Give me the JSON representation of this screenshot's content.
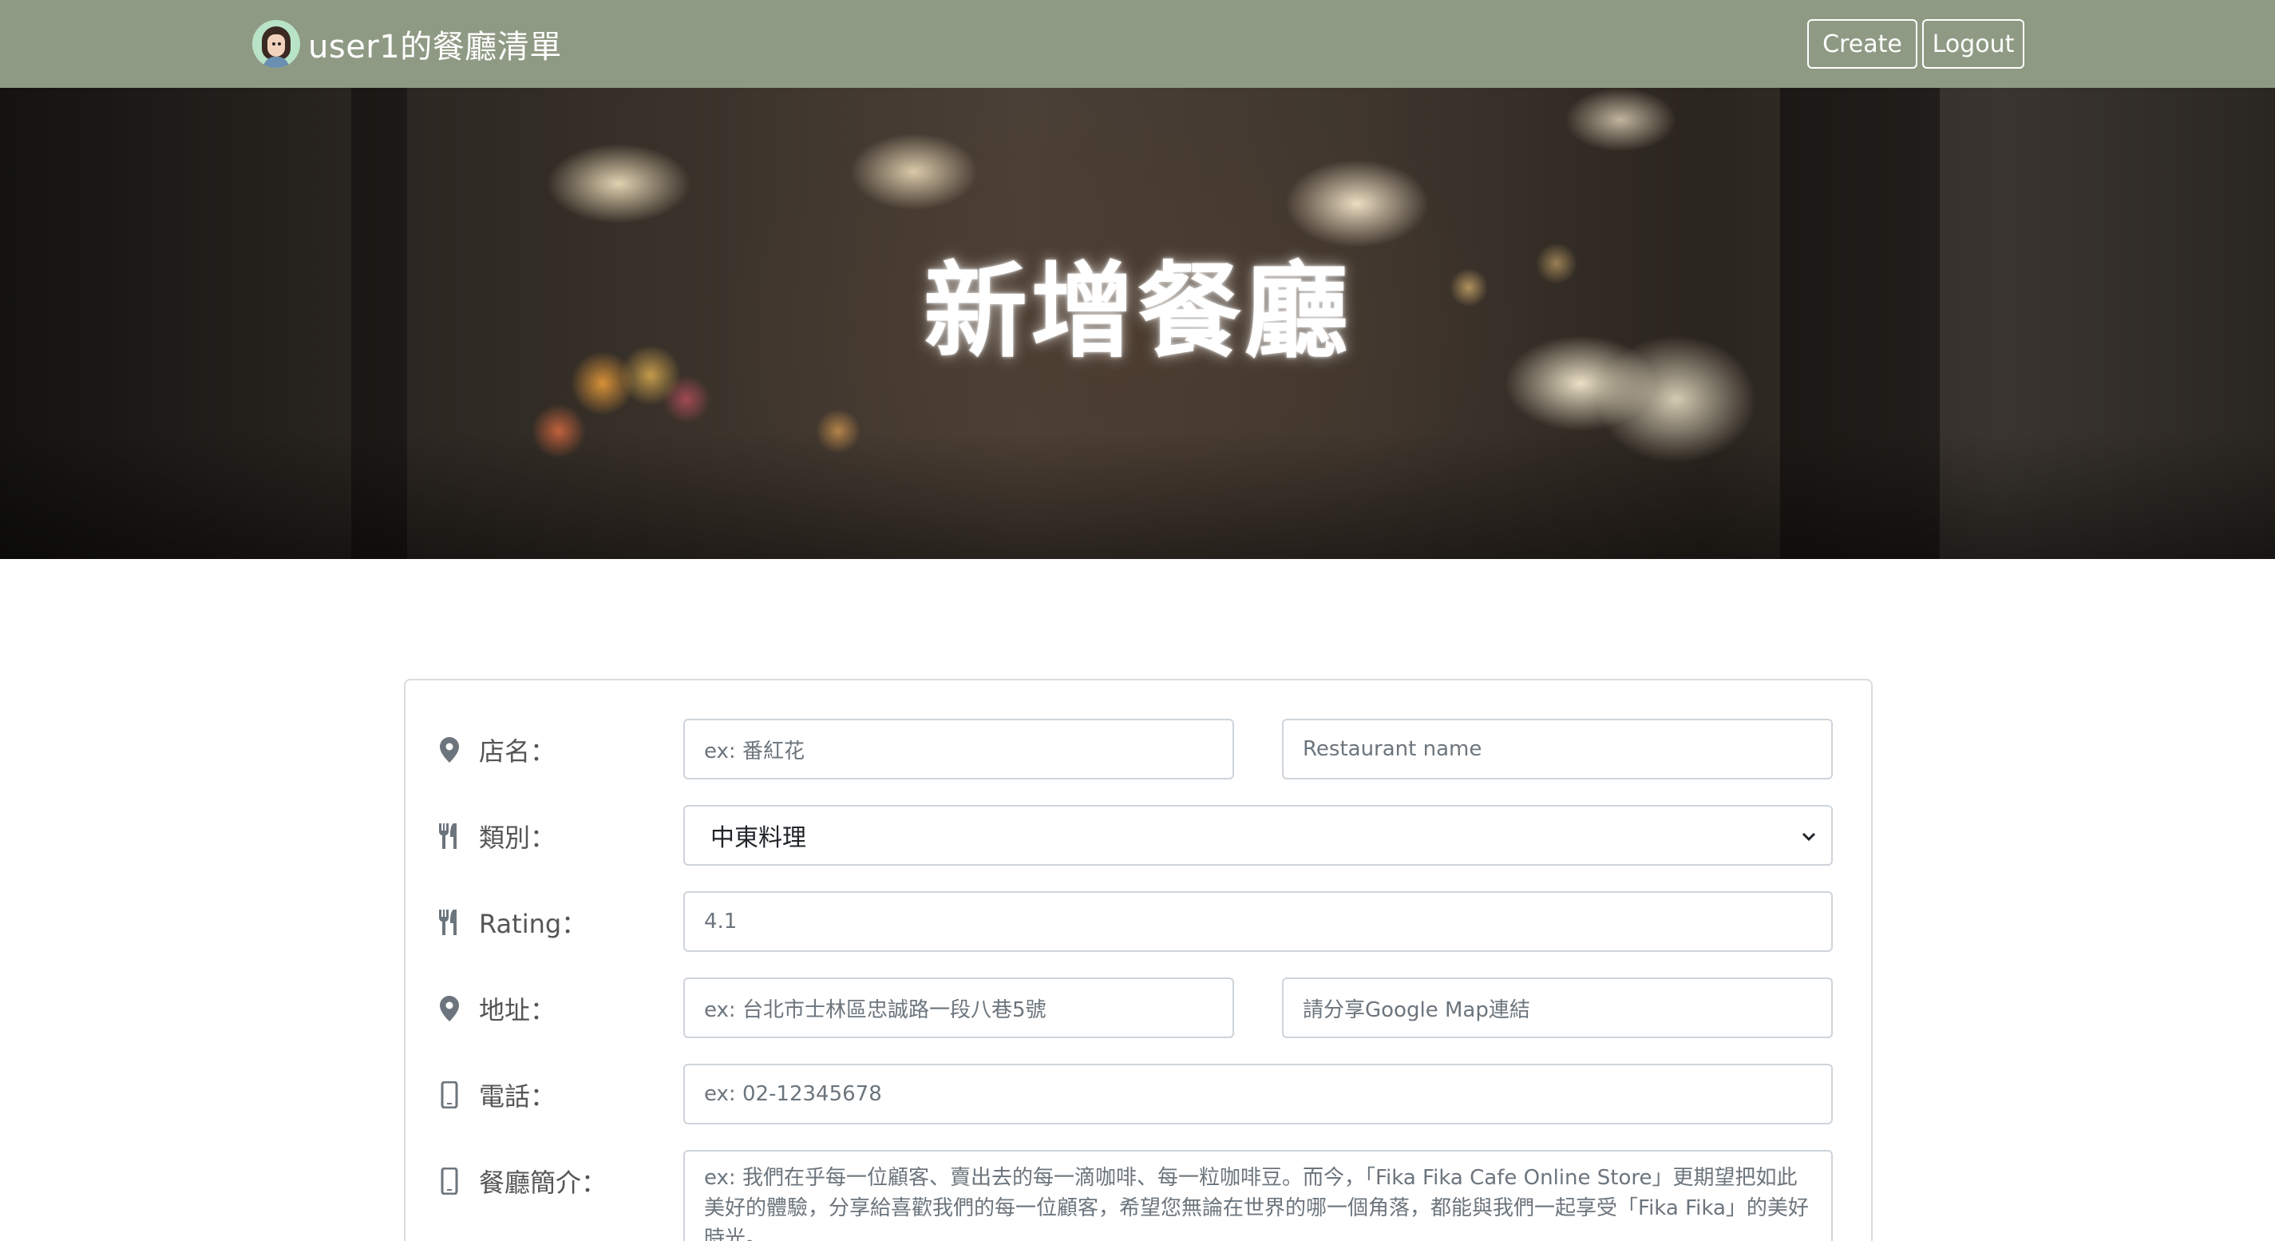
{
  "navbar": {
    "brand_title": "user1的餐廳清單",
    "create_label": "Create",
    "logout_label": "Logout"
  },
  "hero": {
    "title": "新增餐廳"
  },
  "form": {
    "name_label": "店名：",
    "name_placeholder": "ex: 番紅花",
    "name_en_placeholder": "Restaurant name",
    "category_label": "類別：",
    "category_selected": "中東料理",
    "rating_label": "Rating：",
    "rating_value": "4.1",
    "address_label": "地址：",
    "address_placeholder": "ex: 台北市士林區忠誠路一段八巷5號",
    "map_placeholder": "請分享Google Map連結",
    "phone_label": "電話：",
    "phone_placeholder": "ex: 02-12345678",
    "description_label": "餐廳簡介：",
    "description_placeholder": "ex: 我們在乎每一位顧客、賣出去的每一滴咖啡、每一粒咖啡豆。而今，「Fika Fika Cafe Online Store」更期望把如此美好的體驗，分享給喜歡我們的每一位顧客，希望您無論在世界的哪一個角落，都能與我們一起享受「Fika Fika」的美好時光。"
  },
  "icons": {
    "map_pin": "map-pin-icon",
    "utensils": "utensils-icon",
    "phone": "mobile-phone-icon"
  },
  "colors": {
    "navbar_bg": "#8f9a84",
    "icon_gray": "#6c757d"
  }
}
